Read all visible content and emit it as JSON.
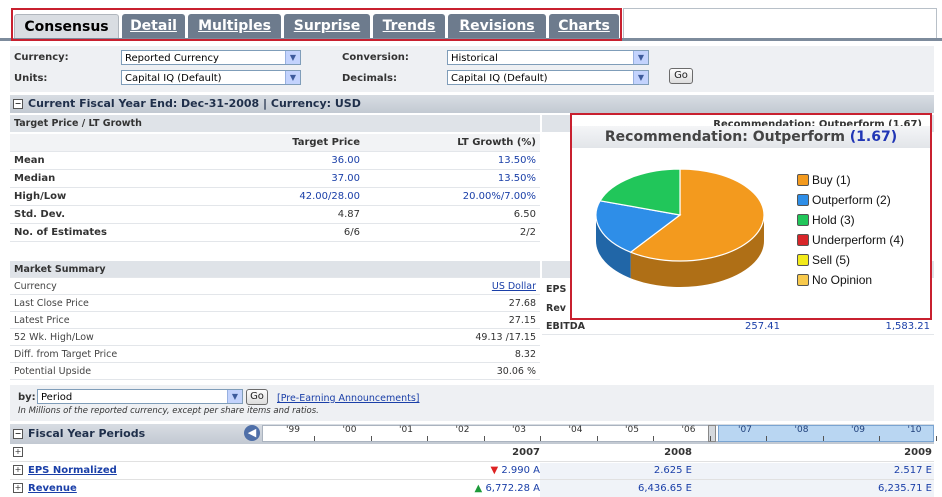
{
  "tabs": [
    "Consensus",
    "Detail",
    "Multiples",
    "Surprise",
    "Trends",
    "Revisions",
    "Charts"
  ],
  "filters": {
    "currency_label": "Currency:",
    "currency_value": "Reported Currency",
    "units_label": "Units:",
    "units_value": "Capital IQ (Default)",
    "conversion_label": "Conversion:",
    "conversion_value": "Historical",
    "decimals_label": "Decimals:",
    "decimals_value": "Capital IQ (Default)",
    "go": "Go"
  },
  "fiscal_header": "Current Fiscal Year End: Dec-31-2008 | Currency: USD",
  "target": {
    "section": "Target Price / LT Growth",
    "col1": "Target Price",
    "col2": "LT Growth (%)",
    "rows": [
      {
        "label": "Mean",
        "v1": "36.00",
        "v2": "13.50%"
      },
      {
        "label": "Median",
        "v1": "37.00",
        "v2": "13.50%"
      },
      {
        "label": "High/Low",
        "v1": "42.00/28.00",
        "v2": "20.00%/7.00%"
      },
      {
        "label": "Std. Dev.",
        "v1": "4.87",
        "v2": "6.50"
      },
      {
        "label": "No. of Estimates",
        "v1": "6/6",
        "v2": "2/2"
      }
    ]
  },
  "recommendation_bg": "Recommendation: Outperform (1.67)",
  "market": {
    "title": "Market Summary",
    "rows": [
      {
        "label": "Currency",
        "value": "US Dollar"
      },
      {
        "label": "Last Close Price",
        "value": "27.68"
      },
      {
        "label": "Latest Price",
        "value": "27.15"
      },
      {
        "label": "52 Wk. High/Low",
        "value": "49.13 /17.15"
      },
      {
        "label": "Diff. from Target Price",
        "value": "8.32"
      },
      {
        "label": "Potential Upside",
        "value": "30.06 %"
      }
    ]
  },
  "partial": {
    "eps": "EPS",
    "rev": "Rev",
    "ebitda": "EBITDA",
    "ebitda_v1": "257.41",
    "ebitda_v2": "1,583.21"
  },
  "popup": {
    "title": "Recommendation: Outperform",
    "score": "(1.67)",
    "legend": [
      {
        "label": "Buy (1)",
        "color": "#f39a1e"
      },
      {
        "label": "Outperform (2)",
        "color": "#2e8ee8"
      },
      {
        "label": "Hold (3)",
        "color": "#21c65a"
      },
      {
        "label": "Underperform (4)",
        "color": "#d8262a"
      },
      {
        "label": "Sell (5)",
        "color": "#f2ea1a"
      },
      {
        "label": "No Opinion",
        "color": "#f7c94c"
      }
    ]
  },
  "chart_data": {
    "type": "pie",
    "categories": [
      "Buy (1)",
      "Outperform (2)",
      "Hold (3)",
      "Underperform (4)",
      "Sell (5)",
      "No Opinion"
    ],
    "values": [
      3,
      1,
      1,
      0,
      0,
      0
    ],
    "title": "Recommendation: Outperform (1.67)"
  },
  "period": {
    "by_label": "by:",
    "value": "Period",
    "go": "Go",
    "link": "[Pre-Earning Announcements]",
    "note": "In Millions of the reported currency, except per share items and ratios."
  },
  "fiscal_periods": {
    "title": "Fiscal Year Periods",
    "timeline": [
      "'99",
      "'00",
      "'01",
      "'02",
      "'03",
      "'04",
      "'05",
      "'06",
      "'07",
      "'08",
      "'09",
      "'10"
    ],
    "years": [
      "2007",
      "2008",
      "2009"
    ],
    "rows": [
      {
        "label": "EPS Normalized",
        "v1": "2.990 A",
        "v2": "2.625 E",
        "v3": "2.517 E",
        "dir": "down"
      },
      {
        "label": "Revenue",
        "v1": "6,772.28 A",
        "v2": "6,436.65 E",
        "v3": "6,235.71 E",
        "dir": "up"
      }
    ]
  }
}
